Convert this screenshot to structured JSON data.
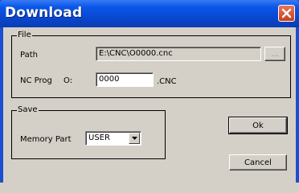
{
  "window": {
    "title": "Download"
  },
  "file_group": {
    "legend": "File",
    "path_label": "Path",
    "path_value": "E:\\CNC\\O0000.cnc",
    "browse_label": "...",
    "ncprog_label": "NC Prog",
    "ncprog_prefix": "O:",
    "ncprog_value": "0000",
    "ncprog_suffix": ".CNC"
  },
  "save_group": {
    "legend": "Save",
    "memory_label": "Memory Part",
    "memory_value": "USER"
  },
  "buttons": {
    "ok": "Ok",
    "cancel": "Cancel"
  },
  "icons": {
    "close": "close-icon",
    "dropdown": "chevron-down-icon"
  }
}
